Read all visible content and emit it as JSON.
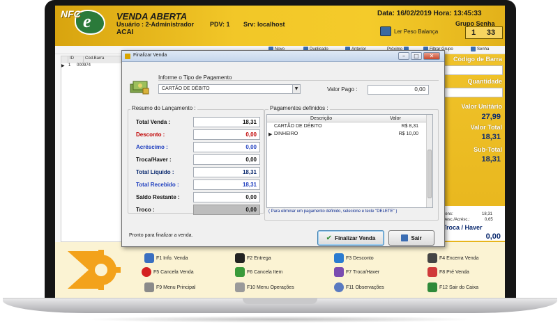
{
  "header": {
    "logo_text": "NFC e",
    "title": "VENDA ABERTA",
    "user": "Usuário : 2-Administrador",
    "pdv": "PDV: 1",
    "server": "Srv: localhost",
    "shop": "ACAI",
    "datetime": "Data: 16/02/2019 Hora: 13:45:33",
    "scale_button": "Ler Peso Balança",
    "group_label": "Grupo Senha",
    "group_value": "1",
    "password_value": "33"
  },
  "toolbar": [
    "Novo",
    "Duplicado",
    "Anterior",
    "Próximo",
    "Filtrar Grupo",
    "Senha"
  ],
  "left_table": {
    "columns": [
      "ID",
      "Cod.Barra"
    ],
    "rows": [
      {
        "marker": "▶",
        "id": "1",
        "code": "000974"
      }
    ]
  },
  "right_panel": {
    "barcode_label": "Código de Barra",
    "qty_label": "Quantidade",
    "unit_price_label": "Valor Unitário",
    "unit_price": "27,99",
    "total_label": "Valor Total",
    "total": "18,31",
    "subtotal_label": "Sub-Total",
    "subtotal": "18,31",
    "small_lines": [
      {
        "label": "Itens:",
        "value": "18,31"
      },
      {
        "label": "Desc./Acrésc.:",
        "value": "0,65"
      }
    ],
    "change_label": "Troca / Haver",
    "change_value": "0,00"
  },
  "function_keys": [
    {
      "label": "F1  Info. Venda"
    },
    {
      "label": "F2  Entrega"
    },
    {
      "label": "F3  Desconto"
    },
    {
      "label": "F4  Encerra Venda"
    },
    {
      "label": "F5  Cancela Venda"
    },
    {
      "label": "F6  Cancela Item"
    },
    {
      "label": "F7  Troca/Haver"
    },
    {
      "label": "F8  Pré Venda"
    },
    {
      "label": "F9  Menu Principal"
    },
    {
      "label": "F10  Menu Operações"
    },
    {
      "label": "F11  Observações"
    },
    {
      "label": "F12  Sair do Caixa"
    }
  ],
  "dialog": {
    "title": "Finalizar Venda",
    "payment_type_label": "Informe o Tipo de Pagamento",
    "payment_type_value": "CARTÃO DE DÉBITO",
    "paid_value_label": "Valor Pago :",
    "paid_value": "0,00",
    "summary_label": "Resumo do Lançamento :",
    "summary": [
      {
        "label": "Total Venda :",
        "value": "18,31",
        "color": "#111111"
      },
      {
        "label": "Desconto :",
        "value": "0,00",
        "color": "#c00000"
      },
      {
        "label": "Acréscimo :",
        "value": "0,00",
        "color": "#1f3fbf"
      },
      {
        "label": "Troca/Haver :",
        "value": "0,00",
        "color": "#111111"
      },
      {
        "label": "Total Líquido :",
        "value": "18,31",
        "color": "#0b2a6f"
      },
      {
        "label": "Total Recebido :",
        "value": "18,31",
        "color": "#1f3fbf"
      },
      {
        "label": "Saldo Restante :",
        "value": "0,00",
        "color": "#111111"
      },
      {
        "label": "Troco :",
        "value": "0,00",
        "color": "#111111"
      }
    ],
    "payments_label": "Pagamentos definidos :",
    "payments_columns": [
      "Descrição",
      "Valor"
    ],
    "payments": [
      {
        "marker": "",
        "desc": "CARTÃO DE DÉBITO",
        "value": "R$ 8,31"
      },
      {
        "marker": "▶",
        "desc": "DINHEIRO",
        "value": "R$ 10,00"
      }
    ],
    "hint": "( Para eliminar um pagamento definido, selecione e tecle \"DELETE\" )",
    "status": "Pronto para finalizar a venda.",
    "finalize_button": "Finalizar Venda",
    "exit_button": "Sair"
  },
  "colors": {
    "header_gold": "#f2c728",
    "accent_blue": "#0b2a6f"
  }
}
